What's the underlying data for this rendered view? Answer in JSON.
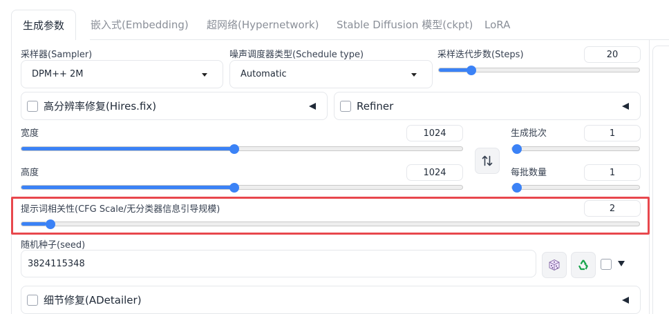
{
  "tabs": [
    {
      "label": "生成参数",
      "active": true
    },
    {
      "label": "嵌入式(Embedding)"
    },
    {
      "label": "超网络(Hypernetwork)"
    },
    {
      "label": "Stable Diffusion 模型(ckpt)"
    },
    {
      "label": "LoRA"
    }
  ],
  "sampler": {
    "label": "采样器(Sampler)",
    "value": "DPM++ 2M"
  },
  "schedule": {
    "label": "噪声调度器类型(Schedule type)",
    "value": "Automatic"
  },
  "steps": {
    "label": "采样迭代步数(Steps)",
    "value": "20",
    "fraction": 0.145
  },
  "hires": {
    "label": "高分辨率修复(Hires.fix)",
    "checked": false
  },
  "refiner": {
    "label": "Refiner",
    "checked": false
  },
  "width": {
    "label": "宽度",
    "value": "1024",
    "fraction": 0.483
  },
  "height": {
    "label": "高度",
    "value": "1024",
    "fraction": 0.483
  },
  "batch_count": {
    "label": "生成批次",
    "value": "1",
    "fraction": 0.0
  },
  "batch_size": {
    "label": "每批数量",
    "value": "1",
    "fraction": 0.0
  },
  "cfg": {
    "label": "提示词相关性(CFG Scale/无分类器信息引导规模)",
    "value": "2",
    "fraction": 0.04
  },
  "seed": {
    "label": "随机种子(seed)",
    "value": "3824115348"
  },
  "adetailer": {
    "label": "细节修复(ADetailer)",
    "checked": false
  },
  "icons": {
    "swap": "swap-vertical-icon",
    "dice": "dice-icon",
    "recycle": "recycle-icon",
    "extra_toggle": "triangle-down-icon"
  },
  "colors": {
    "accent": "#3b82f6",
    "highlight": "#e8474d"
  }
}
